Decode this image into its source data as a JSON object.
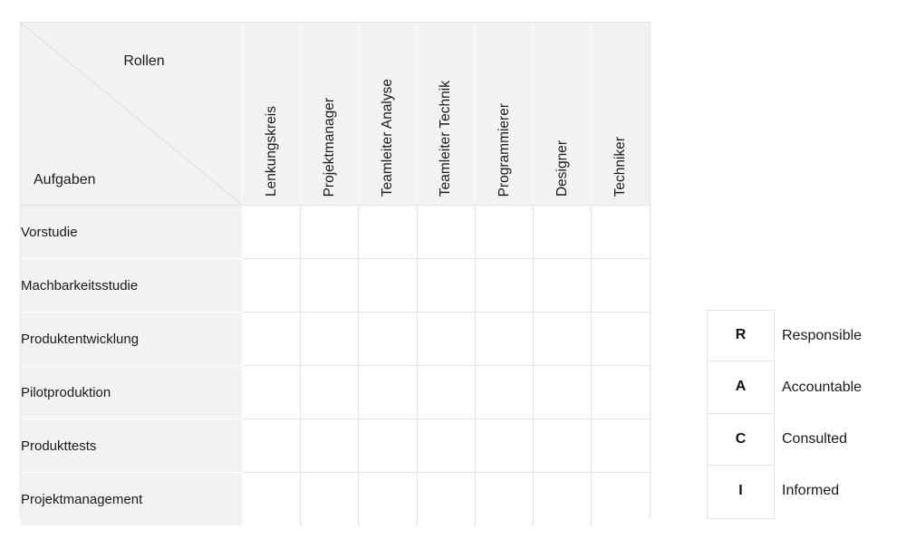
{
  "matrix": {
    "corner": {
      "roles_label": "Rollen",
      "tasks_label": "Aufgaben"
    },
    "columns": [
      "Lenkungskreis",
      "Projektmanager",
      "Teamleiter Analyse",
      "Teamleiter Technik",
      "Programmierer",
      "Designer",
      "Techniker"
    ],
    "rows": [
      {
        "task": "Vorstudie",
        "cells": [
          "",
          "",
          "",
          "",
          "",
          "",
          ""
        ]
      },
      {
        "task": "Machbarkeitsstudie",
        "cells": [
          "",
          "",
          "",
          "",
          "",
          "",
          ""
        ]
      },
      {
        "task": "Produktentwicklung",
        "cells": [
          "",
          "",
          "",
          "",
          "",
          "",
          ""
        ]
      },
      {
        "task": "Pilotproduktion",
        "cells": [
          "",
          "",
          "",
          "",
          "",
          "",
          ""
        ]
      },
      {
        "task": "Produkttests",
        "cells": [
          "",
          "",
          "",
          "",
          "",
          "",
          ""
        ]
      },
      {
        "task": "Projektmanagement",
        "cells": [
          "",
          "",
          "",
          "",
          "",
          "",
          ""
        ]
      }
    ]
  },
  "legend": {
    "items": [
      {
        "key": "R",
        "label": "Responsible"
      },
      {
        "key": "A",
        "label": "Accountable"
      },
      {
        "key": "C",
        "label": "Consulted"
      },
      {
        "key": "I",
        "label": "Informed"
      }
    ]
  },
  "colors": {
    "header_fill": "#f2f2f2",
    "grid_line": "#e3e3e3",
    "text": "#1a1a1a",
    "page_background": "#ffffff"
  }
}
